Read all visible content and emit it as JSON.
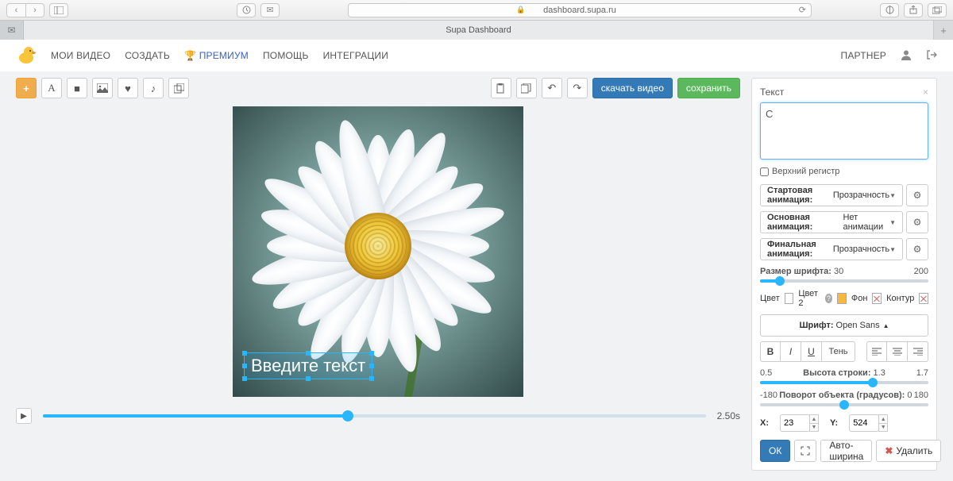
{
  "browser": {
    "url": "dashboard.supa.ru",
    "tab_title": "Supa Dashboard"
  },
  "nav": {
    "items": [
      "МОИ ВИДЕО",
      "СОЗДАТЬ",
      "ПРЕМИУМ",
      "ПОМОЩЬ",
      "ИНТЕГРАЦИИ"
    ],
    "partner": "ПАРТНЕР"
  },
  "toolbar": {
    "download": "скачать видео",
    "save": "сохранить"
  },
  "canvas": {
    "text_placeholder": "Введите текст",
    "time": "2.50s"
  },
  "panel": {
    "title": "Текст",
    "text_value": "С",
    "uppercase": "Верхний регистр",
    "anim_start_label": "Стартовая анимация:",
    "anim_start_val": "Прозрачность",
    "anim_main_label": "Основная анимация:",
    "anim_main_val": "Нет анимации",
    "anim_end_label": "Финальная анимация:",
    "anim_end_val": "Прозрачность",
    "font_size_label": "Размер шрифта:",
    "font_size_val": "30",
    "font_size_max": "200",
    "color_label": "Цвет",
    "color2_label": "Цвет 2",
    "bg_label": "Фон",
    "outline_label": "Контур",
    "font_label": "Шрифт:",
    "font_val": "Open Sans",
    "shadow": "Тень",
    "lh_min": "0.5",
    "lh_label": "Высота строки:",
    "lh_val": "1.3",
    "lh_max": "1.7",
    "rot_min": "-180",
    "rot_label": "Поворот объекта (градусов):",
    "rot_val": "0",
    "rot_max": "180",
    "x_label": "X:",
    "x_val": "23",
    "y_label": "Y:",
    "y_val": "524",
    "ok": "ОК",
    "auto_width": "Авто-ширина",
    "delete": "Удалить"
  }
}
